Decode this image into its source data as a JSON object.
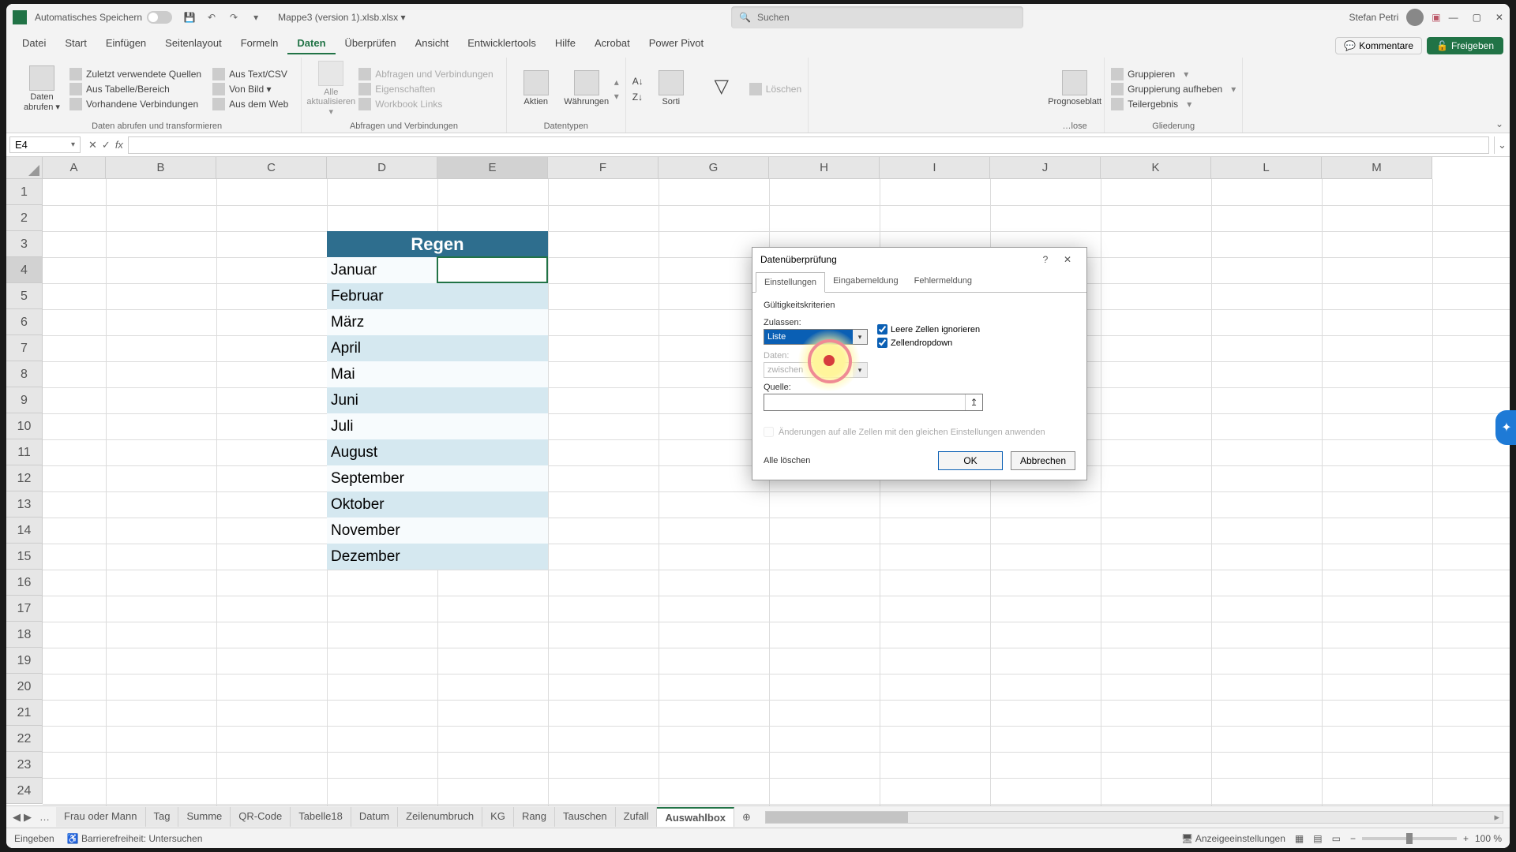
{
  "titlebar": {
    "autosave": "Automatisches Speichern",
    "filename": "Mappe3 (version 1).xlsb.xlsx ▾",
    "search_placeholder": "Suchen",
    "username": "Stefan Petri"
  },
  "tabs": {
    "items": [
      "Datei",
      "Start",
      "Einfügen",
      "Seitenlayout",
      "Formeln",
      "Daten",
      "Überprüfen",
      "Ansicht",
      "Entwicklertools",
      "Hilfe",
      "Acrobat",
      "Power Pivot"
    ],
    "active": 5,
    "comments": "Kommentare",
    "share": "Freigeben"
  },
  "ribbon": {
    "g1_big": "Daten abrufen ▾",
    "g1_items": [
      "Aus Text/CSV",
      "Von Bild ▾",
      "Aus dem Web",
      "Zuletzt verwendete Quellen",
      "Aus Tabelle/Bereich",
      "Vorhandene Verbindungen"
    ],
    "g1_label": "Daten abrufen und transformieren",
    "g2_big": "Alle aktualisieren ▾",
    "g2_items": [
      "Abfragen und Verbindungen",
      "Eigenschaften",
      "Workbook Links"
    ],
    "g2_label": "Abfragen und Verbindungen",
    "g3_a": "Aktien",
    "g3_b": "Währungen",
    "g3_label": "Datentypen",
    "g4_sort": "Sorti",
    "g4_clear": "Löschen",
    "g5_label": "…lose",
    "g5_forecast": "Prognoseblatt",
    "g6_items": [
      "Gruppieren",
      "Gruppierung aufheben",
      "Teilergebnis"
    ],
    "g6_label": "Gliederung"
  },
  "formula": {
    "cellref": "E4"
  },
  "columns": [
    "A",
    "B",
    "C",
    "D",
    "E",
    "F",
    "G",
    "H",
    "I",
    "J",
    "K",
    "L",
    "M"
  ],
  "table": {
    "header": "Regen",
    "months": [
      "Januar",
      "Februar",
      "März",
      "April",
      "Mai",
      "Juni",
      "Juli",
      "August",
      "September",
      "Oktober",
      "November",
      "Dezember"
    ]
  },
  "dialog": {
    "title": "Datenüberprüfung",
    "tabs": [
      "Einstellungen",
      "Eingabemeldung",
      "Fehlermeldung"
    ],
    "section": "Gültigkeitskriterien",
    "allow_label": "Zulassen:",
    "allow_value": "Liste",
    "data_label": "Daten:",
    "data_value": "zwischen",
    "source_label": "Quelle:",
    "chk_ignore": "Leere Zellen ignorieren",
    "chk_dropdown": "Zellendropdown",
    "note": "Änderungen auf alle Zellen mit den gleichen Einstellungen anwenden",
    "clear": "Alle löschen",
    "ok": "OK",
    "cancel": "Abbrechen",
    "refglyph": "↥",
    "help": "?",
    "close": "✕"
  },
  "sheets": {
    "items": [
      "Frau oder Mann",
      "Tag",
      "Summe",
      "QR-Code",
      "Tabelle18",
      "Datum",
      "Zeilenumbruch",
      "KG",
      "Rang",
      "Tauschen",
      "Zufall",
      "Auswahlbox"
    ],
    "active": 11
  },
  "status": {
    "mode": "Eingeben",
    "acc": "Barrierefreiheit: Untersuchen",
    "disp": "Anzeigeeinstellungen",
    "zoom": "100 %"
  }
}
